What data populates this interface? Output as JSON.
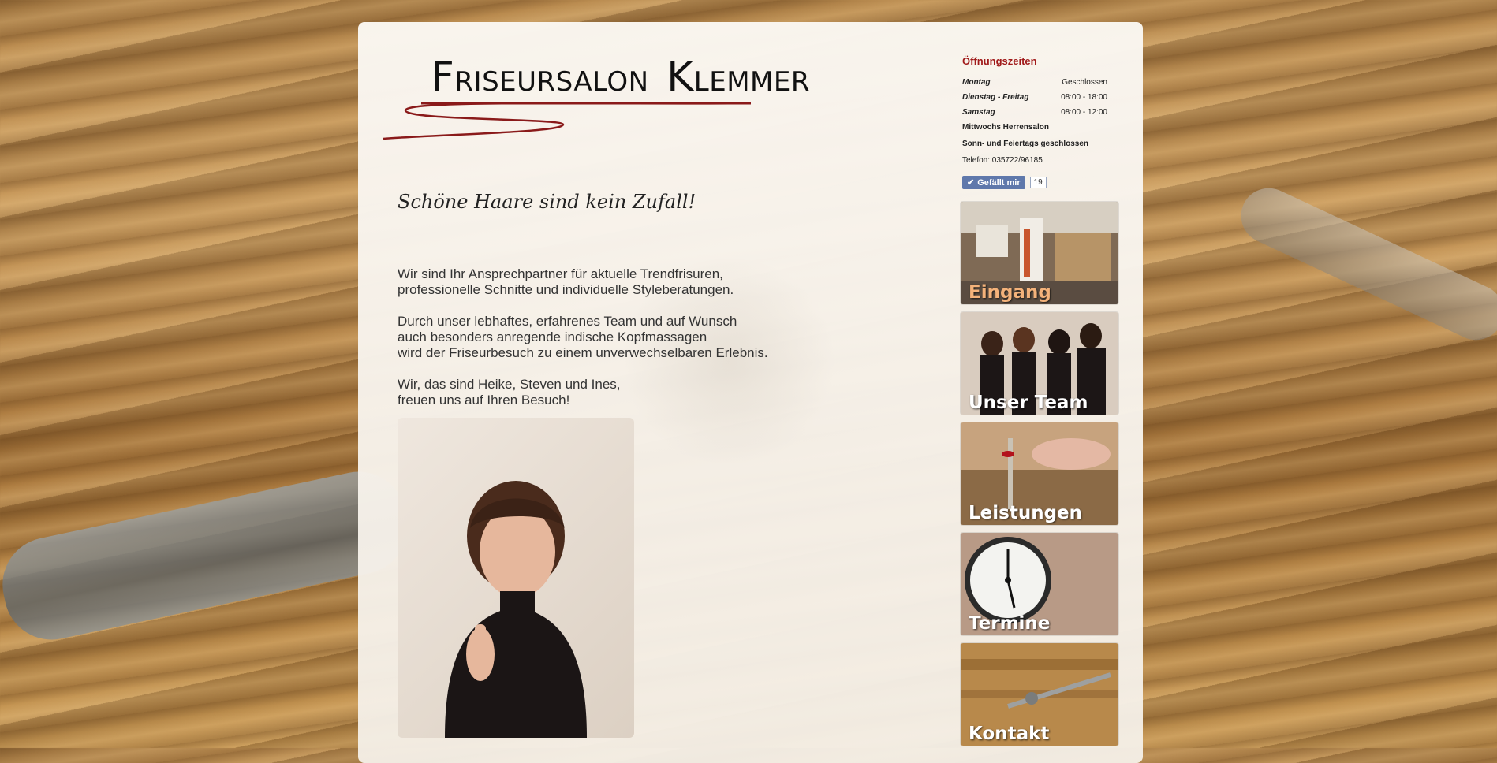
{
  "logo": {
    "initial1": "F",
    "rest1": "RISEURSALON",
    "initial2": "K",
    "rest2": "LEMMER"
  },
  "tagline": "Schöne Haare sind kein Zufall!",
  "intro": {
    "p1": [
      "Wir sind Ihr Ansprechpartner für aktuelle Trendfrisuren,",
      "professionelle Schnitte und individuelle Styleberatungen."
    ],
    "p2": [
      "Durch unser lebhaftes, erfahrenes Team und auf Wunsch",
      "auch besonders anregende indische Kopfmassagen",
      "wird der Friseurbesuch zu einem unverwechselbaren Erlebnis."
    ],
    "p3": [
      "Wir, das sind Heike, Steven und Ines,",
      "freuen uns auf Ihren Besuch!"
    ]
  },
  "hours": {
    "title": "Öffnungszeiten",
    "rows": [
      {
        "day": "Montag",
        "time": "Geschlossen"
      },
      {
        "day": "Dienstag - Freitag",
        "time": "08:00 - 18:00"
      },
      {
        "day": "Samstag",
        "time": "08:00 - 12:00"
      }
    ],
    "note1": "Mittwochs Herrensalon",
    "note2": "Sonn- und Feiertags geschlossen",
    "phone": "Telefon: 035722/96185"
  },
  "like": {
    "label": "Gefällt mir",
    "count": "19"
  },
  "tiles": [
    {
      "label": "Eingang",
      "color": "#f4b27a"
    },
    {
      "label": "Unser Team",
      "color": "#ffffff"
    },
    {
      "label": "Leistungen",
      "color": "#ffffff"
    },
    {
      "label": "Termine",
      "color": "#ffffff"
    },
    {
      "label": "Kontakt",
      "color": "#ffffff"
    }
  ]
}
